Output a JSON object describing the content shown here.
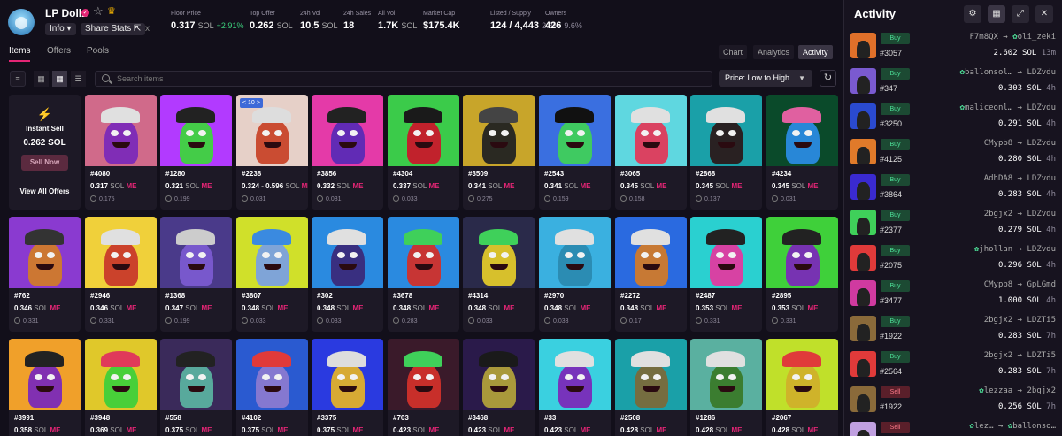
{
  "collection": {
    "name": "LP Dollz",
    "verified_icon": "verified-badge-icon",
    "info_label": "Info",
    "share_label": "Share Stats",
    "close_label": "x"
  },
  "stats": [
    {
      "label": "Floor Price",
      "value": "0.317",
      "unit": "SOL",
      "extra": "+2.91%"
    },
    {
      "label": "Top Offer",
      "value": "0.262",
      "unit": "SOL",
      "extra": ""
    },
    {
      "label": "24h Vol",
      "value": "10.5",
      "unit": "SOL",
      "extra": ""
    },
    {
      "label": "24h Sales",
      "value": "18",
      "unit": "",
      "extra": ""
    },
    {
      "label": "All Vol",
      "value": "1.7K",
      "unit": "SOL",
      "extra": ""
    },
    {
      "label": "Market Cap",
      "value": "$175.4K",
      "unit": "",
      "extra": ""
    },
    {
      "label": "Listed / Supply",
      "value": "124 / 4,443",
      "unit": "",
      "extra": "2.8%"
    },
    {
      "label": "Owners",
      "value": "426",
      "unit": "",
      "extra": "9.6%"
    }
  ],
  "tabs": [
    "Items",
    "Offers",
    "Pools"
  ],
  "view_tabs": [
    "Chart",
    "Analytics",
    "Activity"
  ],
  "search": {
    "placeholder": "Search items"
  },
  "sort": {
    "label": "Price: Low to High"
  },
  "instant_sell": {
    "title": "Instant Sell",
    "price": "0.262 SOL",
    "button": "Sell Now",
    "link": "View All Offers"
  },
  "currency": "SOL",
  "me_label": "ME",
  "items": [
    {
      "name": "#4080",
      "price": "0.317",
      "last": "0.175",
      "colors": [
        "#d06a8a",
        "#7b2ab8",
        "#e0e0e0"
      ]
    },
    {
      "name": "#1280",
      "price": "0.321",
      "last": "0.199",
      "colors": [
        "#b23aff",
        "#3ed43e",
        "#222"
      ]
    },
    {
      "name": "#2238",
      "price": "0.324 - 0.596",
      "last": "0.031",
      "colors": [
        "#e6d0c8",
        "#c8442a",
        "#ddd"
      ],
      "badge": "< 10 >"
    },
    {
      "name": "#3856",
      "price": "0.332",
      "last": "0.031",
      "colors": [
        "#e43aa8",
        "#5a2ab5",
        "#222"
      ]
    },
    {
      "name": "#4304",
      "price": "0.337",
      "last": "0.033",
      "colors": [
        "#3bcb4a",
        "#c8182a",
        "#1a1a1a"
      ]
    },
    {
      "name": "#3509",
      "price": "0.341",
      "last": "0.275",
      "colors": [
        "#c8a52a",
        "#222",
        "#444"
      ]
    },
    {
      "name": "#2543",
      "price": "0.341",
      "last": "0.159",
      "colors": [
        "#3a6fe0",
        "#3fcf5a",
        "#111"
      ]
    },
    {
      "name": "#3065",
      "price": "0.345",
      "last": "0.158",
      "colors": [
        "#5fd7e0",
        "#e03a5a",
        "#e0e0e0"
      ]
    },
    {
      "name": "#2868",
      "price": "0.345",
      "last": "0.137",
      "colors": [
        "#1aa0a8",
        "#2a1a1a",
        "#e0e0e0"
      ]
    },
    {
      "name": "#4234",
      "price": "0.345",
      "last": "0.031",
      "colors": [
        "#0a4a2a",
        "#2a8ae0",
        "#e060a0"
      ]
    },
    {
      "name": "#762",
      "price": "0.346",
      "last": "0.331",
      "colors": [
        "#8a3ad0",
        "#d07a2a",
        "#333"
      ]
    },
    {
      "name": "#2946",
      "price": "0.346",
      "last": "0.331",
      "colors": [
        "#f0d03a",
        "#c83a2a",
        "#e0e0e0"
      ]
    },
    {
      "name": "#1368",
      "price": "0.347",
      "last": "0.199",
      "colors": [
        "#4a3a8a",
        "#7a5ad0",
        "#ccc"
      ]
    },
    {
      "name": "#3807",
      "price": "0.348",
      "last": "0.033",
      "colors": [
        "#d0e02a",
        "#7aa0e0",
        "#3a8ae0"
      ]
    },
    {
      "name": "#302",
      "price": "0.348",
      "last": "0.033",
      "colors": [
        "#2a8ae0",
        "#3a2a7a",
        "#e0e0e0"
      ]
    },
    {
      "name": "#3678",
      "price": "0.348",
      "last": "0.283",
      "colors": [
        "#2a8ae0",
        "#d0302a",
        "#3fd05a"
      ]
    },
    {
      "name": "#4314",
      "price": "0.348",
      "last": "0.033",
      "colors": [
        "#2a2a4a",
        "#e0c82a",
        "#3fd05a"
      ]
    },
    {
      "name": "#2970",
      "price": "0.348",
      "last": "0.033",
      "colors": [
        "#3ab0e0",
        "#2a8ab0",
        "#e0e0e0"
      ]
    },
    {
      "name": "#2272",
      "price": "0.348",
      "last": "0.17",
      "colors": [
        "#2a6ae0",
        "#d07a2a",
        "#e0e0e0"
      ]
    },
    {
      "name": "#2487",
      "price": "0.353",
      "last": "0.331",
      "colors": [
        "#2ad0d0",
        "#e03aa0",
        "#222"
      ]
    },
    {
      "name": "#2895",
      "price": "0.353",
      "last": "0.331",
      "colors": [
        "#3fd03a",
        "#7a2ab8",
        "#222"
      ]
    },
    {
      "name": "#3991",
      "price": "0.358",
      "last": "",
      "colors": [
        "#f0a02a",
        "#7a2ab8",
        "#222"
      ]
    },
    {
      "name": "#3948",
      "price": "0.369",
      "last": "",
      "colors": [
        "#e0c82a",
        "#3fd03a",
        "#e03a5a"
      ]
    },
    {
      "name": "#558",
      "price": "0.375",
      "last": "",
      "colors": [
        "#3a2a5a",
        "#5ab0a0",
        "#222"
      ]
    },
    {
      "name": "#4102",
      "price": "0.375",
      "last": "",
      "colors": [
        "#2a5ad0",
        "#8a7ad0",
        "#e03a3a"
      ]
    },
    {
      "name": "#3375",
      "price": "0.375",
      "last": "",
      "colors": [
        "#2a3ae0",
        "#e0b02a",
        "#ddd"
      ]
    },
    {
      "name": "#703",
      "price": "0.423",
      "last": "",
      "colors": [
        "#3a1a2a",
        "#d0302a",
        "#3fd05a"
      ]
    },
    {
      "name": "#3468",
      "price": "0.423",
      "last": "",
      "colors": [
        "#2a1a4a",
        "#b0a03a",
        "#1a1a1a"
      ]
    },
    {
      "name": "#33",
      "price": "0.423",
      "last": "",
      "colors": [
        "#3ad0e0",
        "#7a2ab8",
        "#e0e0e0"
      ]
    },
    {
      "name": "#2508",
      "price": "0.428",
      "last": "",
      "colors": [
        "#1aa0a8",
        "#7a6a3a",
        "#e0e0e0"
      ]
    },
    {
      "name": "#1286",
      "price": "0.428",
      "last": "",
      "colors": [
        "#5ab0a0",
        "#3a7a2a",
        "#e0e0e0"
      ]
    },
    {
      "name": "#2067",
      "price": "0.428",
      "last": "",
      "colors": [
        "#c0e02a",
        "#d0b02a",
        "#e03a3a"
      ]
    }
  ],
  "activity": {
    "title": "Activity",
    "rows": [
      {
        "type": "Buy",
        "id": "#3057",
        "from": "F7m8QX",
        "to": "oli_zeki",
        "to_k": true,
        "from_k": false,
        "amount": "2.602",
        "time": "13m",
        "color": "#e0702a"
      },
      {
        "type": "Buy",
        "id": "#347",
        "from": "ballonsol…",
        "to": "LDZvdu",
        "to_k": false,
        "from_k": true,
        "amount": "0.303",
        "time": "4h",
        "color": "#7a5ad0"
      },
      {
        "type": "Buy",
        "id": "#3250",
        "from": "maliceonl…",
        "to": "LDZvdu",
        "to_k": false,
        "from_k": true,
        "amount": "0.291",
        "time": "4h",
        "color": "#2a4ad0"
      },
      {
        "type": "Buy",
        "id": "#4125",
        "from": "CMypb8",
        "to": "LDZvdu",
        "to_k": false,
        "from_k": false,
        "amount": "0.280",
        "time": "4h",
        "color": "#e07a2a"
      },
      {
        "type": "Buy",
        "id": "#3864",
        "from": "AdhDA8",
        "to": "LDZvdu",
        "to_k": false,
        "from_k": false,
        "amount": "0.283",
        "time": "4h",
        "color": "#3a2ad0"
      },
      {
        "type": "Buy",
        "id": "#2377",
        "from": "2bgjx2",
        "to": "LDZvdu",
        "to_k": false,
        "from_k": false,
        "amount": "0.279",
        "time": "4h",
        "color": "#3fd05a"
      },
      {
        "type": "Buy",
        "id": "#2075",
        "from": "jhollan",
        "to": "LDZvdu",
        "to_k": false,
        "from_k": true,
        "amount": "0.296",
        "time": "4h",
        "color": "#e03a3a"
      },
      {
        "type": "Buy",
        "id": "#3477",
        "from": "CMypb8",
        "to": "GpLGmd",
        "to_k": false,
        "from_k": false,
        "amount": "1.000",
        "time": "4h",
        "color": "#d03aa0"
      },
      {
        "type": "Buy",
        "id": "#1922",
        "from": "2bgjx2",
        "to": "LDZTi5",
        "to_k": false,
        "from_k": false,
        "amount": "0.283",
        "time": "7h",
        "color": "#8a6a3a"
      },
      {
        "type": "Buy",
        "id": "#2564",
        "from": "2bgjx2",
        "to": "LDZTi5",
        "to_k": false,
        "from_k": false,
        "amount": "0.283",
        "time": "7h",
        "color": "#e03a3a"
      },
      {
        "type": "Sell",
        "id": "#1922",
        "from": "lezzaa",
        "to": "2bgjx2",
        "to_k": false,
        "from_k": true,
        "amount": "0.256",
        "time": "7h",
        "color": "#8a6a3a"
      },
      {
        "type": "Sell",
        "id": "",
        "from": "lez…",
        "to": "ballonso…",
        "to_k": true,
        "from_k": true,
        "amount": "",
        "time": "",
        "color": "#c0a0e0"
      }
    ]
  }
}
